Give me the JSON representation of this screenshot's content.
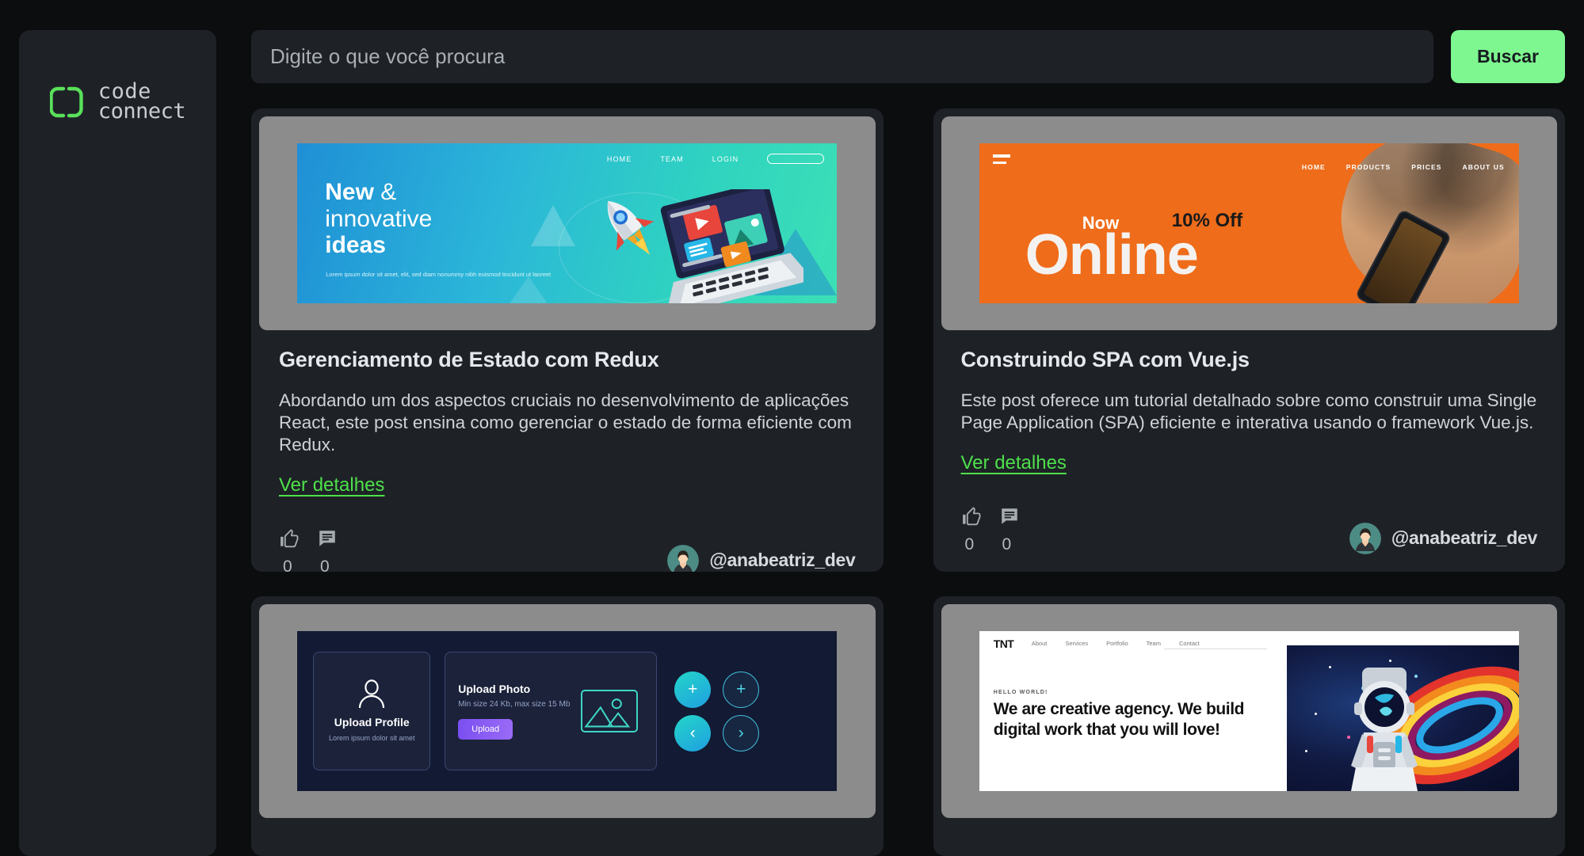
{
  "brand": {
    "logo_line1": "code",
    "logo_line2": "connect",
    "accent_green": "#7ef790",
    "link_green": "#4ee04a",
    "page_bg": "#0b0d0f",
    "panel_bg": "#1e2227"
  },
  "search": {
    "placeholder": "Digite o que você procura",
    "value": "",
    "button_label": "Buscar"
  },
  "posts": [
    {
      "title": "Gerenciamento de Estado com Redux",
      "description": "Abordando um dos aspectos cruciais no desenvolvimento de aplicações React, este post ensina como gerenciar o estado de forma eficiente com Redux.",
      "link_label": "Ver detalhes",
      "likes": "0",
      "comments": "0",
      "author": "@anabeatriz_dev",
      "cover": {
        "style": "new-innovative-ideas",
        "nav": [
          "HOME",
          "TEAM",
          "LOGIN"
        ],
        "headline_bold_1": "New",
        "headline_amp": "&",
        "headline_regular": "innovative",
        "headline_bold_2": "ideas",
        "lorem": "Lorem ipsum dolor sit amet, elit, sed diam nonummy nibh euismod tincidunt ut laoreet"
      }
    },
    {
      "title": "Construindo SPA com Vue.js",
      "description": "Este post oferece um tutorial detalhado sobre como construir uma Single Page Application (SPA) eficiente e interativa usando o framework Vue.js.",
      "link_label": "Ver detalhes",
      "likes": "0",
      "comments": "0",
      "author": "@anabeatriz_dev",
      "cover": {
        "style": "now-online-promo",
        "nav": [
          "HOME",
          "PRODUCTS",
          "PRICES",
          "ABOUT US"
        ],
        "kicker": "Now",
        "badge": "10% Off",
        "headline": "Online"
      }
    },
    {
      "title": "",
      "description": "",
      "link_label": "",
      "likes": "",
      "comments": "",
      "author": "",
      "cover": {
        "style": "upload-ui-kit",
        "profile_title": "Upload Profile",
        "profile_sub": "Lorem ipsum dolor sit amet",
        "photo_title": "Upload Photo",
        "photo_sub": "Min size 24 Kb, max size 15 Mb",
        "upload_button": "Upload"
      }
    },
    {
      "title": "",
      "description": "",
      "link_label": "",
      "likes": "",
      "comments": "",
      "author": "",
      "cover": {
        "style": "tnt-creative-agency",
        "logo": "TNT",
        "nav": [
          "About",
          "Services",
          "Portfolio",
          "Team",
          "Contact"
        ],
        "kicker": "HELLO WORLD!",
        "headline": "We are creative agency. We build digital work that you will love!"
      }
    }
  ]
}
